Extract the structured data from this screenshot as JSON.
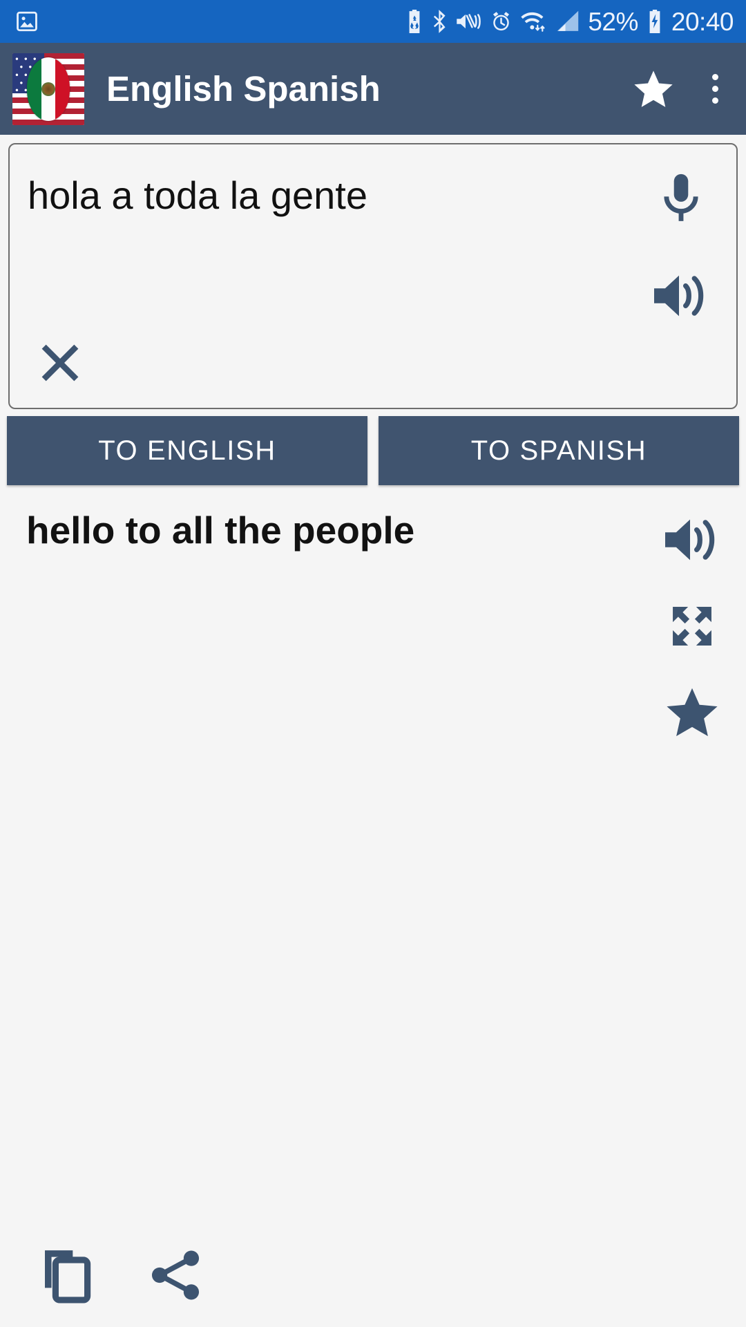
{
  "status_bar": {
    "background": "#1565c0",
    "icons_left": [
      "image-icon"
    ],
    "icons_right": [
      "battery-saver-icon",
      "bluetooth-icon",
      "vibrate-mute-icon",
      "alarm-icon",
      "wifi-icon",
      "signal-icon"
    ],
    "battery_percent": "52%",
    "battery_state_icon": "battery-charging-icon",
    "time": "20:40"
  },
  "app_bar": {
    "background": "#40546f",
    "app_icon": "us-mexico-flag-icon",
    "title": "English Spanish",
    "actions": [
      {
        "name": "favorite-star-icon",
        "label": "star"
      },
      {
        "name": "overflow-menu-icon",
        "label": "more options"
      }
    ]
  },
  "input": {
    "value": "hola a toda la gente",
    "placeholder": "",
    "mic_icon": "microphone-icon",
    "speak_icon": "speaker-icon",
    "clear_icon": "close-icon"
  },
  "direction_buttons": [
    {
      "label": "TO ENGLISH",
      "name": "to-english-button"
    },
    {
      "label": "TO SPANISH",
      "name": "to-spanish-button"
    }
  ],
  "result": {
    "text": "hello to all the people",
    "speak_icon": "speaker-icon",
    "expand_icon": "fullscreen-icon",
    "star_icon": "star-icon"
  },
  "bottom_bar": {
    "copy_icon": "copy-icon",
    "share_icon": "share-icon"
  },
  "colors": {
    "status_bar": "#1565c0",
    "app_bar": "#40546f",
    "accent": "#40546f",
    "page_background": "#f5f5f5",
    "text_primary": "#121212"
  }
}
